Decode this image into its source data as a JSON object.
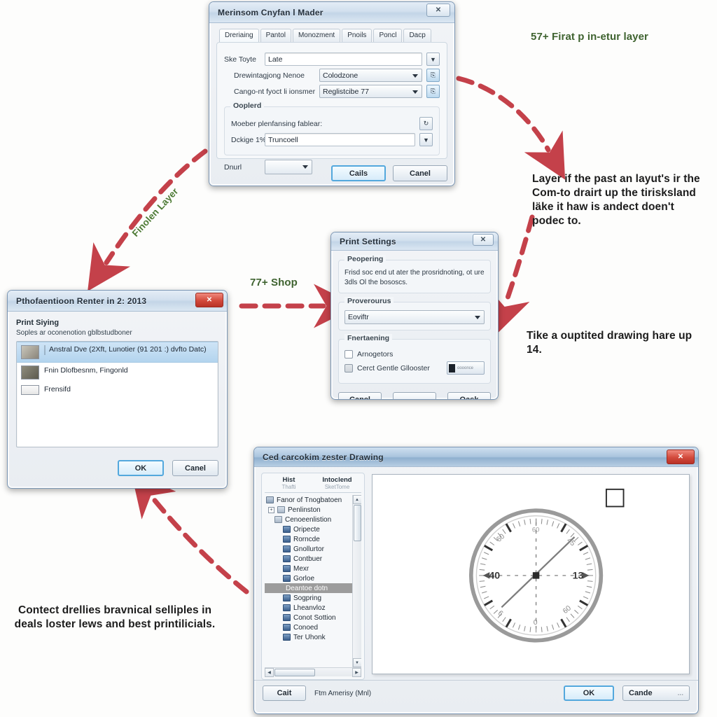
{
  "page": {
    "background": "#fdfdfc",
    "arrow_color": "#c4414a",
    "green_label_color": "#3f6330"
  },
  "layer_dialog": {
    "title": "Merinsom Cnyfan l Mader",
    "close_label": "✕",
    "tabs": [
      {
        "label": "Dreriaing",
        "active": true
      },
      {
        "label": "Pantol",
        "active": false
      },
      {
        "label": "Monozment",
        "active": false
      },
      {
        "label": "Pnoils",
        "active": false
      },
      {
        "label": "Poncl",
        "active": false
      },
      {
        "label": "Dacp",
        "active": false
      }
    ],
    "fields": [
      {
        "label": "Ske Toyte",
        "value": "Late",
        "type": "text",
        "button": "▼"
      },
      {
        "label": "Drewintagjong Nenoe",
        "value": "Colodzone",
        "type": "combo",
        "button": "⎘"
      },
      {
        "label": "Cango-nt fyoct li ionsmer",
        "value": "Reglistcibe 77",
        "type": "combo",
        "button": "⎘"
      }
    ],
    "group": {
      "title": "Ooplerd",
      "rows": [
        {
          "label": "Moeber plenfansing fablear:",
          "value": "",
          "type": "text",
          "button": "↻"
        },
        {
          "label": "Dckige 1%",
          "value": "Truncoell",
          "type": "text",
          "button": "▼"
        }
      ]
    },
    "bottom_field": {
      "label": "Dnurl",
      "value": "",
      "button": "▾"
    },
    "buttons": {
      "ok": "Cails",
      "cancel": "Canel"
    }
  },
  "print_settings": {
    "title": "Print Settings",
    "close_label": "✕",
    "groups": [
      {
        "title": "Peopering",
        "text": "Frisd soc end ut ater the prosridnoting, ot ure 3dls Ol the bososcs."
      },
      {
        "title": "Proverourus",
        "combo_value": "Eoviftr"
      },
      {
        "title": "Fnertaening",
        "checkbox_label": "Arnogetors",
        "checkbox2_label": "Cerct Gentle Gllooster",
        "swatch_label": "oooonce"
      }
    ],
    "buttons": {
      "cancel": "Cancl",
      "middle": "-",
      "ok": "Oask"
    }
  },
  "publication_dialog": {
    "title": "Pthofaentioon Renter in 2: 2013",
    "close_label": "✕",
    "group_title": "Print Siying",
    "subtitle": "Soples ar oconenotion gblbstudboner",
    "items": [
      {
        "text": "Anstral Dve (2Xft, Lunotier (91 201 :)  dvfto Datc)",
        "selected": true,
        "thumb": "c"
      },
      {
        "text": "Fnin Dlofbesnm, Fingonld",
        "selected": false,
        "thumb": "d"
      },
      {
        "text": "Frensifd",
        "selected": false,
        "thumb": "e"
      }
    ],
    "buttons": {
      "ok": "OK",
      "cancel": "Canel"
    }
  },
  "drawing_window": {
    "title": "Ced carcokim zester Drawing",
    "close_label": "✕",
    "panel_tabs": [
      {
        "label": "Hist",
        "sublabel": "Thafti"
      },
      {
        "label": "Intoclend",
        "sublabel": "SketTome"
      }
    ],
    "tree": [
      {
        "label": "Fanor of Tnogbatoen",
        "depth": 0,
        "icon": "root",
        "selected": false,
        "expander": ""
      },
      {
        "label": "Penlinston",
        "depth": 1,
        "icon": "plain",
        "selected": false,
        "expander": "+"
      },
      {
        "label": "Cenoeenlistion",
        "depth": 1,
        "icon": "plain",
        "selected": false,
        "expander": ""
      },
      {
        "label": "Oripecte",
        "depth": 2,
        "icon": "leaf",
        "selected": false,
        "expander": ""
      },
      {
        "label": "Rorncde",
        "depth": 2,
        "icon": "leaf",
        "selected": false,
        "expander": ""
      },
      {
        "label": "Gnollurtor",
        "depth": 2,
        "icon": "leaf",
        "selected": false,
        "expander": ""
      },
      {
        "label": "Contbuer",
        "depth": 2,
        "icon": "leaf",
        "selected": false,
        "expander": ""
      },
      {
        "label": "Mexr",
        "depth": 2,
        "icon": "leaf",
        "selected": false,
        "expander": ""
      },
      {
        "label": "Gorloe",
        "depth": 2,
        "icon": "leaf",
        "selected": false,
        "expander": ""
      },
      {
        "label": "Deantoe dotn",
        "depth": 2,
        "icon": "none",
        "selected": true,
        "expander": ""
      },
      {
        "label": "Sogpring",
        "depth": 2,
        "icon": "leaf",
        "selected": false,
        "expander": ""
      },
      {
        "label": "Lheanvloz",
        "depth": 2,
        "icon": "leaf",
        "selected": false,
        "expander": ""
      },
      {
        "label": "Conot Sottion",
        "depth": 2,
        "icon": "leaf",
        "selected": false,
        "expander": ""
      },
      {
        "label": "Conoed",
        "depth": 2,
        "icon": "leaf",
        "selected": false,
        "expander": ""
      },
      {
        "label": "Ter Uhonk",
        "depth": 2,
        "icon": "leaf",
        "selected": false,
        "expander": ""
      }
    ],
    "statusbar": {
      "left_button": "Cait",
      "status_text": "Ftm Amerisy (Mnl)",
      "ok": "OK",
      "cancel": "Cande",
      "more": "..."
    },
    "canvas": {
      "gauge_labels": [
        "40",
        "13",
        "60",
        "45",
        "60",
        "0",
        "6"
      ],
      "marker": "square-handle"
    }
  },
  "annotations": [
    {
      "id": "a1",
      "text": "57+ Firat p in-etur layer",
      "style": "green"
    },
    {
      "id": "a2",
      "text": "Layer if the past an layut's ir the Com-to drairt up the tirisksland läke it haw is andect doen't podec to.",
      "style": "dark"
    },
    {
      "id": "a3",
      "text": "Tike a ouptited drawing hare up 14.",
      "style": "dark"
    },
    {
      "id": "a4",
      "text": "77+ Shop",
      "style": "green"
    },
    {
      "id": "a5",
      "text": "Finolen Layer",
      "style": "rotated-green"
    },
    {
      "id": "a6",
      "text": "Contect drellies bravnical selliples in deals loster lews and best printilicials.",
      "style": "dark"
    }
  ]
}
